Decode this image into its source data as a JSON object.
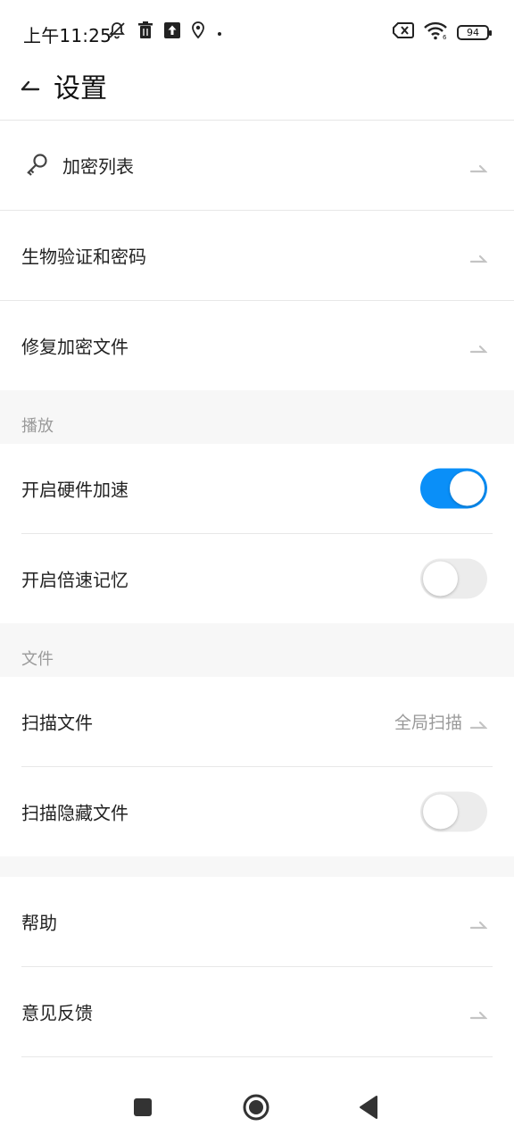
{
  "status": {
    "time": "上午11:25",
    "battery": "94",
    "left_icons": [
      "bell-off-icon",
      "trash-icon",
      "upload-icon",
      "location-icon",
      "dot-icon"
    ],
    "right_icons": [
      "sim-none-icon",
      "wifi-icon",
      "battery-icon"
    ]
  },
  "header": {
    "title": "设置",
    "back_icon": "back-arrow-icon"
  },
  "rows": {
    "encrypt_list": {
      "label": "加密列表",
      "icon": "key-icon"
    },
    "bio_password": {
      "label": "生物验证和密码"
    },
    "repair_files": {
      "label": "修复加密文件"
    },
    "hw_accel": {
      "label": "开启硬件加速",
      "enabled": true
    },
    "speed_memory": {
      "label": "开启倍速记忆",
      "enabled": false
    },
    "scan_files": {
      "label": "扫描文件",
      "value": "全局扫描"
    },
    "scan_hidden": {
      "label": "扫描隐藏文件",
      "enabled": false
    },
    "help": {
      "label": "帮助"
    },
    "feedback": {
      "label": "意见反馈"
    }
  },
  "sections": {
    "playback": "播放",
    "files": "文件"
  },
  "colors": {
    "toggle_on": "#0a8ff8",
    "toggle_off": "#ececec",
    "section_bg": "#f7f7f7"
  },
  "nav": [
    "recents-square-icon",
    "home-circle-icon",
    "back-triangle-icon"
  ]
}
